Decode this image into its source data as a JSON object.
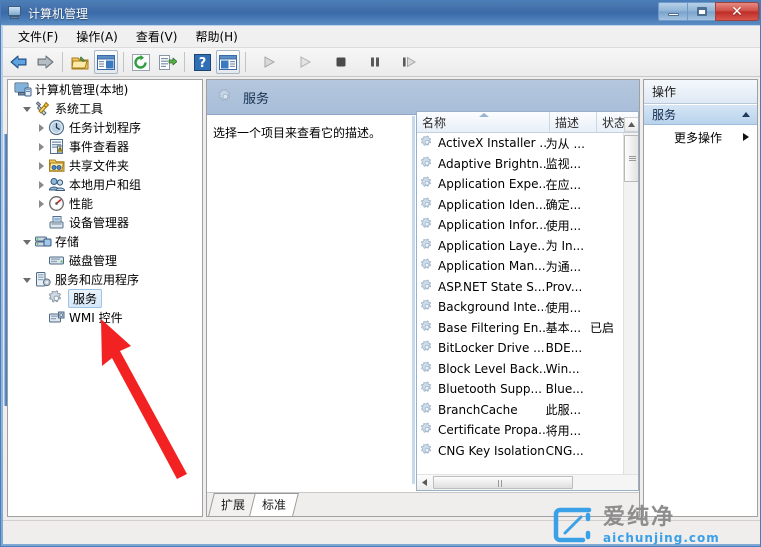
{
  "window": {
    "title": "计算机管理",
    "title_icon": "computer-icon",
    "controls": {
      "minimize": "最小化",
      "maximize": "最大化",
      "close": "关闭"
    }
  },
  "menubar": {
    "items": [
      {
        "label": "文件(F)",
        "name": "menu-file"
      },
      {
        "label": "操作(A)",
        "name": "menu-action"
      },
      {
        "label": "查看(V)",
        "name": "menu-view"
      },
      {
        "label": "帮助(H)",
        "name": "menu-help"
      }
    ]
  },
  "toolbar": {
    "buttons": [
      {
        "icon": "back-arrow-icon",
        "enabled": true
      },
      {
        "icon": "forward-arrow-icon",
        "enabled": true
      },
      {
        "icon": "folder-up-icon",
        "enabled": true
      },
      {
        "icon": "show-tree-pane-icon",
        "enabled": true
      },
      {
        "icon": "refresh-icon",
        "enabled": true
      },
      {
        "icon": "export-list-icon",
        "enabled": true
      },
      {
        "icon": "help-icon",
        "enabled": true
      },
      {
        "icon": "show-action-pane-icon",
        "enabled": true
      },
      {
        "icon": "start-service-icon",
        "enabled": false
      },
      {
        "icon": "resume-service-icon",
        "enabled": false
      },
      {
        "icon": "stop-service-icon",
        "enabled": false
      },
      {
        "icon": "pause-service-icon",
        "enabled": false
      },
      {
        "icon": "restart-service-icon",
        "enabled": false
      }
    ]
  },
  "tree": {
    "nodes": [
      {
        "label": "计算机管理(本地)",
        "icon": "computer-icon",
        "depth": 0,
        "twisty": "none",
        "selected": false
      },
      {
        "label": "系统工具",
        "icon": "tools-icon",
        "depth": 1,
        "twisty": "open",
        "selected": false
      },
      {
        "label": "任务计划程序",
        "icon": "clock-icon",
        "depth": 2,
        "twisty": "closed",
        "selected": false
      },
      {
        "label": "事件查看器",
        "icon": "event-viewer-icon",
        "depth": 2,
        "twisty": "closed",
        "selected": false
      },
      {
        "label": "共享文件夹",
        "icon": "shared-folder-icon",
        "depth": 2,
        "twisty": "closed",
        "selected": false
      },
      {
        "label": "本地用户和组",
        "icon": "users-icon",
        "depth": 2,
        "twisty": "closed",
        "selected": false
      },
      {
        "label": "性能",
        "icon": "performance-icon",
        "depth": 2,
        "twisty": "closed",
        "selected": false
      },
      {
        "label": "设备管理器",
        "icon": "device-manager-icon",
        "depth": 2,
        "twisty": "none",
        "selected": false
      },
      {
        "label": "存储",
        "icon": "storage-icon",
        "depth": 1,
        "twisty": "open",
        "selected": false
      },
      {
        "label": "磁盘管理",
        "icon": "disk-icon",
        "depth": 2,
        "twisty": "none",
        "selected": false
      },
      {
        "label": "服务和应用程序",
        "icon": "services-apps-icon",
        "depth": 1,
        "twisty": "open",
        "selected": false
      },
      {
        "label": "服务",
        "icon": "gear-icon",
        "depth": 2,
        "twisty": "none",
        "selected": true
      },
      {
        "label": "WMI 控件",
        "icon": "wmi-control-icon",
        "depth": 2,
        "twisty": "none",
        "selected": false
      }
    ]
  },
  "center": {
    "header_title": "服务",
    "header_icon": "gear-icon",
    "description": "选择一个项目来查看它的描述。",
    "tabs": [
      {
        "label": "扩展",
        "active": false
      },
      {
        "label": "标准",
        "active": true
      }
    ]
  },
  "service_list": {
    "columns": [
      {
        "label": "名称",
        "sort": "asc"
      },
      {
        "label": "描述",
        "sort": "none"
      },
      {
        "label": "状态",
        "sort": "none"
      }
    ],
    "rows": [
      {
        "name": "ActiveX Installer ...",
        "desc": "为从 ...",
        "status": ""
      },
      {
        "name": "Adaptive Brightn...",
        "desc": "监视...",
        "status": ""
      },
      {
        "name": "Application Expe...",
        "desc": "在应...",
        "status": ""
      },
      {
        "name": "Application Iden...",
        "desc": "确定...",
        "status": ""
      },
      {
        "name": "Application Infor...",
        "desc": "使用...",
        "status": ""
      },
      {
        "name": "Application Laye...",
        "desc": "为 In...",
        "status": ""
      },
      {
        "name": "Application Man...",
        "desc": "为通...",
        "status": ""
      },
      {
        "name": "ASP.NET State S...",
        "desc": "Prov...",
        "status": ""
      },
      {
        "name": "Background Inte...",
        "desc": "使用...",
        "status": ""
      },
      {
        "name": "Base Filtering En...",
        "desc": "基本...",
        "status": "已启"
      },
      {
        "name": "BitLocker Drive ...",
        "desc": "BDE...",
        "status": ""
      },
      {
        "name": "Block Level Back...",
        "desc": "Win...",
        "status": ""
      },
      {
        "name": "Bluetooth Supp...",
        "desc": "Blue...",
        "status": ""
      },
      {
        "name": "BranchCache",
        "desc": "此服...",
        "status": ""
      },
      {
        "name": "Certificate Propa...",
        "desc": "将用...",
        "status": ""
      },
      {
        "name": "CNG Key Isolation",
        "desc": "CNG...",
        "status": ""
      }
    ]
  },
  "actions": {
    "header": "操作",
    "group": "服务",
    "more_label": "更多操作"
  },
  "watermark": {
    "cn": "爱纯净",
    "en": "aichunjing.com",
    "logo_color": "#3aa0e8"
  },
  "annotation": {
    "arrow_color": "#f22222",
    "points_to": "服务"
  }
}
